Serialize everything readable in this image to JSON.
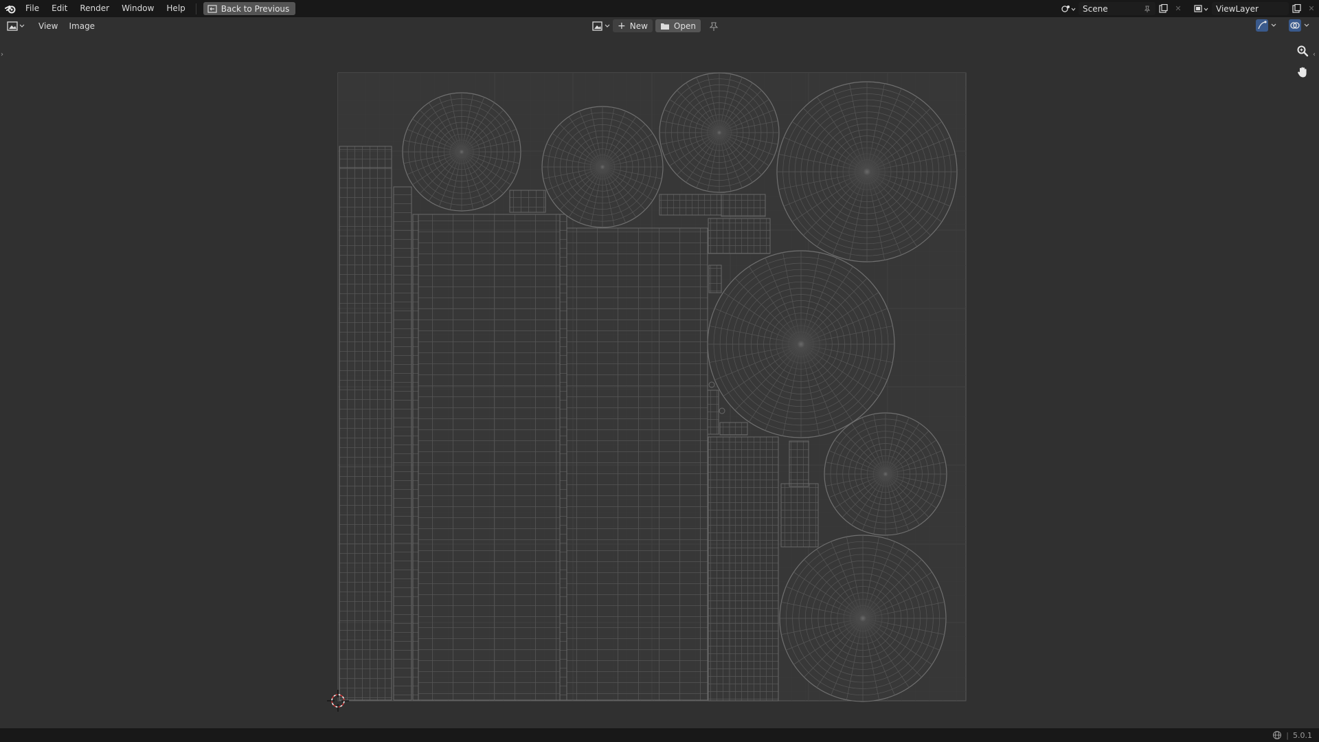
{
  "topbar": {
    "menus": [
      "File",
      "Edit",
      "Render",
      "Window",
      "Help"
    ],
    "back_button": "Back to Previous",
    "scene_label": "Scene",
    "view_layer_label": "ViewLayer"
  },
  "header": {
    "menus": [
      "View",
      "Image"
    ],
    "new_label": "New",
    "open_label": "Open"
  },
  "status": {
    "version": "5.0.1"
  },
  "icons": {
    "logo": "blender-logo-icon",
    "editor_type": "image-editor-icon",
    "zoom": "zoom-icon",
    "pan": "hand-pan-icon",
    "cursor": "2d-cursor-icon"
  }
}
